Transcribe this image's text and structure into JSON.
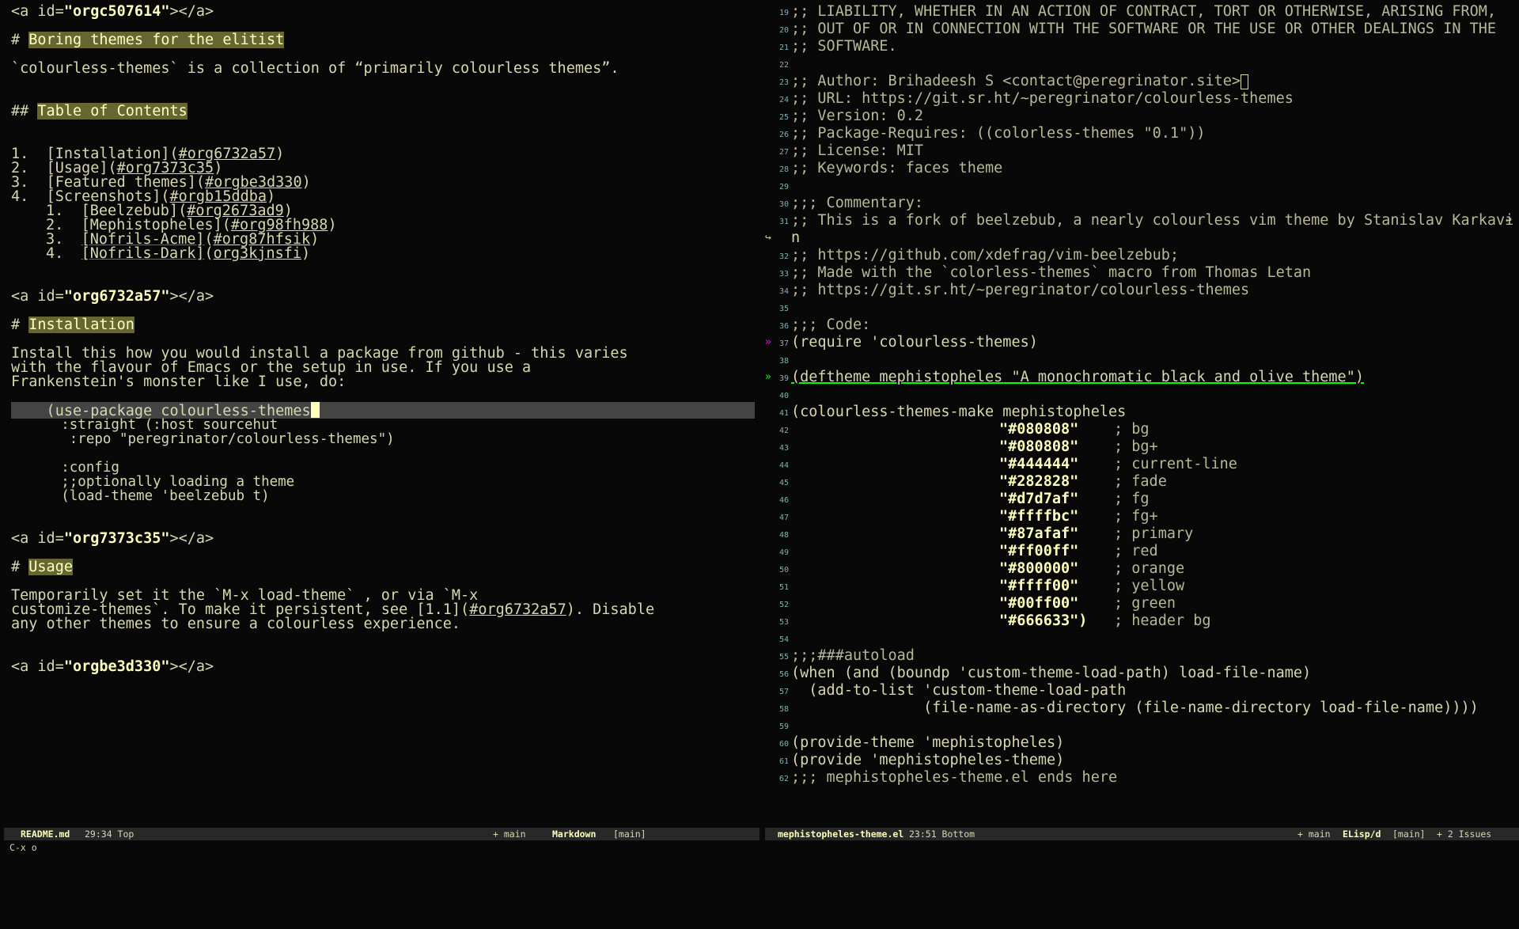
{
  "left": {
    "anchor1_pre": "<a id=",
    "anchor1_id": "\"orgc507614\"",
    "anchor1_post": "></a>",
    "h1_prefix": "# ",
    "h1_title": "Boring themes for the elitist",
    "intro": "`colourless-themes` is a collection of “primarily colourless themes”.",
    "toc_prefix": "## ",
    "toc_title": "Table of Contents",
    "toc": [
      {
        "num": "1.  ",
        "label": "[Installation]",
        "link": "#org6732a57"
      },
      {
        "num": "2.  ",
        "label": "[Usage]",
        "link": "#org7373c35"
      },
      {
        "num": "3.  ",
        "label": "[Featured themes]",
        "link": "#orgbe3d330"
      },
      {
        "num": "4.  ",
        "label": "[Screenshots]",
        "link": "#orgb15ddba"
      }
    ],
    "subtoc": [
      {
        "num": "1.  ",
        "label": "[Beelzebub]",
        "link": "#org2673ad9"
      },
      {
        "num": "2.  ",
        "label": "[Mephistopheles]",
        "link": "#org98fh988"
      },
      {
        "num": "3.  ",
        "label": "[Nofrils-Acme]",
        "link": "#org87hfsik"
      },
      {
        "num": "4.  ",
        "label": "[Nofrils-Dark]",
        "link": "org3kjnsfi"
      }
    ],
    "anchor2_id": "\"org6732a57\"",
    "install_title": "Installation",
    "install_p1": "Install this how you would install a package from github - this varies",
    "install_p2": "with the flavour of Emacs or the setup in use. If you use a",
    "install_p3": "Frankenstein's monster like I use, do:",
    "code1": "    (use-package colourless-themes",
    "code2": "      :straight (:host sourcehut",
    "code3": "       :repo \"peregrinator/colourless-themes\")",
    "code4": "      :config",
    "code5": "      ;;optionally loading a theme",
    "code6": "      (load-theme 'beelzebub t)",
    "anchor3_id": "\"org7373c35\"",
    "usage_title": "Usage",
    "usage_p1": "Temporarily set it the `M-x load-theme` , or via `M-x",
    "usage_p2a": "customize-themes`. To make it persistent, see [1.1](",
    "usage_p2link": "#org6732a57",
    "usage_p2b": "). Disable",
    "usage_p3": "any other themes to ensure a colourless experience.",
    "anchor4_id": "\"orgbe3d330\""
  },
  "right": {
    "lines": [
      {
        "n": "19",
        "t": ";; LIABILITY, WHETHER IN AN ACTION OF CONTRACT, TORT OR OTHERWISE, ARISING FROM,"
      },
      {
        "n": "20",
        "t": ";; OUT OF OR IN CONNECTION WITH THE SOFTWARE OR THE USE OR OTHER DEALINGS IN THE"
      },
      {
        "n": "21",
        "t": ";; SOFTWARE."
      },
      {
        "n": "22",
        "t": ""
      },
      {
        "n": "23",
        "t": ";; Author: Brihadeesh S <contact@peregrinator.site>"
      },
      {
        "n": "24",
        "t": ";; URL: https://git.sr.ht/~peregrinator/colourless-themes"
      },
      {
        "n": "25",
        "t": ";; Version: 0.2"
      },
      {
        "n": "26",
        "t": ";; Package-Requires: ((colorless-themes \"0.1\"))"
      },
      {
        "n": "27",
        "t": ";; License: MIT"
      },
      {
        "n": "28",
        "t": ";; Keywords: faces theme"
      },
      {
        "n": "29",
        "t": ""
      },
      {
        "n": "30",
        "t": ";;; Commentary:"
      },
      {
        "n": "31",
        "t": ";; This is a fork of beelzebub, a nearly colourless vim theme by Stanislav Karkavi"
      },
      {
        "n": "",
        "t": "n"
      },
      {
        "n": "32",
        "t": ";; https://github.com/xdefrag/vim-beelzebub;"
      },
      {
        "n": "33",
        "t": ";; Made with the `colorless-themes` macro from Thomas Letan"
      },
      {
        "n": "34",
        "t": ";; https://git.sr.ht/~peregrinator/colourless-themes"
      },
      {
        "n": "35",
        "t": ""
      },
      {
        "n": "36",
        "t": ";;; Code:"
      },
      {
        "n": "37",
        "t": "(require 'colourless-themes)"
      },
      {
        "n": "38",
        "t": ""
      },
      {
        "n": "39",
        "t": "(deftheme mephistopheles \"A monochromatic black and olive theme\")"
      },
      {
        "n": "40",
        "t": ""
      },
      {
        "n": "41",
        "t": "(colourless-themes-make mephistopheles"
      }
    ],
    "palette": [
      {
        "n": "42",
        "v": "\"#080808\"",
        "c": "; bg"
      },
      {
        "n": "43",
        "v": "\"#080808\"",
        "c": "; bg+"
      },
      {
        "n": "44",
        "v": "\"#444444\"",
        "c": "; current-line"
      },
      {
        "n": "45",
        "v": "\"#282828\"",
        "c": "; fade"
      },
      {
        "n": "46",
        "v": "\"#d7d7af\"",
        "c": "; fg"
      },
      {
        "n": "47",
        "v": "\"#ffffbc\"",
        "c": "; fg+"
      },
      {
        "n": "48",
        "v": "\"#87afaf\"",
        "c": "; primary"
      },
      {
        "n": "49",
        "v": "\"#ff00ff\"",
        "c": "; red"
      },
      {
        "n": "50",
        "v": "\"#800000\"",
        "c": "; orange"
      },
      {
        "n": "51",
        "v": "\"#ffff00\"",
        "c": "; yellow"
      },
      {
        "n": "52",
        "v": "\"#00ff00\"",
        "c": "; green"
      },
      {
        "n": "53",
        "v": "\"#666633\")",
        "c": "; header bg"
      }
    ],
    "tail": [
      {
        "n": "54",
        "t": ""
      },
      {
        "n": "55",
        "t": ";;;###autoload"
      },
      {
        "n": "56",
        "t": "(when (and (boundp 'custom-theme-load-path) load-file-name)"
      },
      {
        "n": "57",
        "t": "  (add-to-list 'custom-theme-load-path"
      },
      {
        "n": "58",
        "t": "               (file-name-as-directory (file-name-directory load-file-name))))"
      },
      {
        "n": "59",
        "t": ""
      },
      {
        "n": "60",
        "t": "(provide-theme 'mephistopheles)"
      },
      {
        "n": "61",
        "t": "(provide 'mephistopheles-theme)"
      },
      {
        "n": "62",
        "t": ";;; mephistopheles-theme.el ends here"
      }
    ]
  },
  "modeline_left": {
    "file": "README.md",
    "pos": "29:34 Top",
    "branch": "+ main",
    "mode": "Markdown",
    "project": "[main]"
  },
  "modeline_right": {
    "file": "mephistopheles-theme.el",
    "pos": "23:51 Bottom",
    "branch": "+ main",
    "mode": "ELisp/d",
    "project": "[main]",
    "issues": "+ 2 Issues"
  },
  "minibuffer": "C-x o",
  "colors": {
    "bg": "#080808",
    "fg": "#d7d7af",
    "fg_plus": "#ffffbc",
    "header_bg": "#666633",
    "current_line": "#444444",
    "fade": "#282828",
    "primary": "#87afaf",
    "red": "#ff00ff",
    "green": "#00ff00"
  }
}
